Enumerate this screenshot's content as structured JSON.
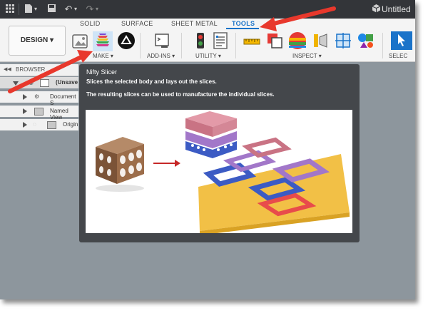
{
  "titlebar": {
    "doc_title": "Untitled"
  },
  "workspace": {
    "design_label": "DESIGN ▾"
  },
  "tabs": [
    {
      "label": "SOLID",
      "active": false
    },
    {
      "label": "SURFACE",
      "active": false
    },
    {
      "label": "SHEET METAL",
      "active": false
    },
    {
      "label": "TOOLS",
      "active": true
    }
  ],
  "groups": {
    "make": "MAKE ▾",
    "addins": "ADD-INS ▾",
    "utility": "UTILITY ▾",
    "inspect": "INSPECT ▾",
    "select": "SELEC"
  },
  "browser": {
    "header": "BROWSER",
    "rows": [
      {
        "label": "(Unsave"
      },
      {
        "label": "Document S"
      },
      {
        "label": "Named View"
      },
      {
        "label": "Origin"
      }
    ]
  },
  "tooltip": {
    "title": "Nifty Slicer",
    "description": "Slices the selected body and lays out the slices.",
    "detail": "The resulting slices can be used to manufacture the individual slices."
  },
  "colors": {
    "accent": "#1a73c9",
    "annotation": "#e8382c",
    "tooltip_bg": "#44474b",
    "workspace_bg": "#8d969d"
  }
}
